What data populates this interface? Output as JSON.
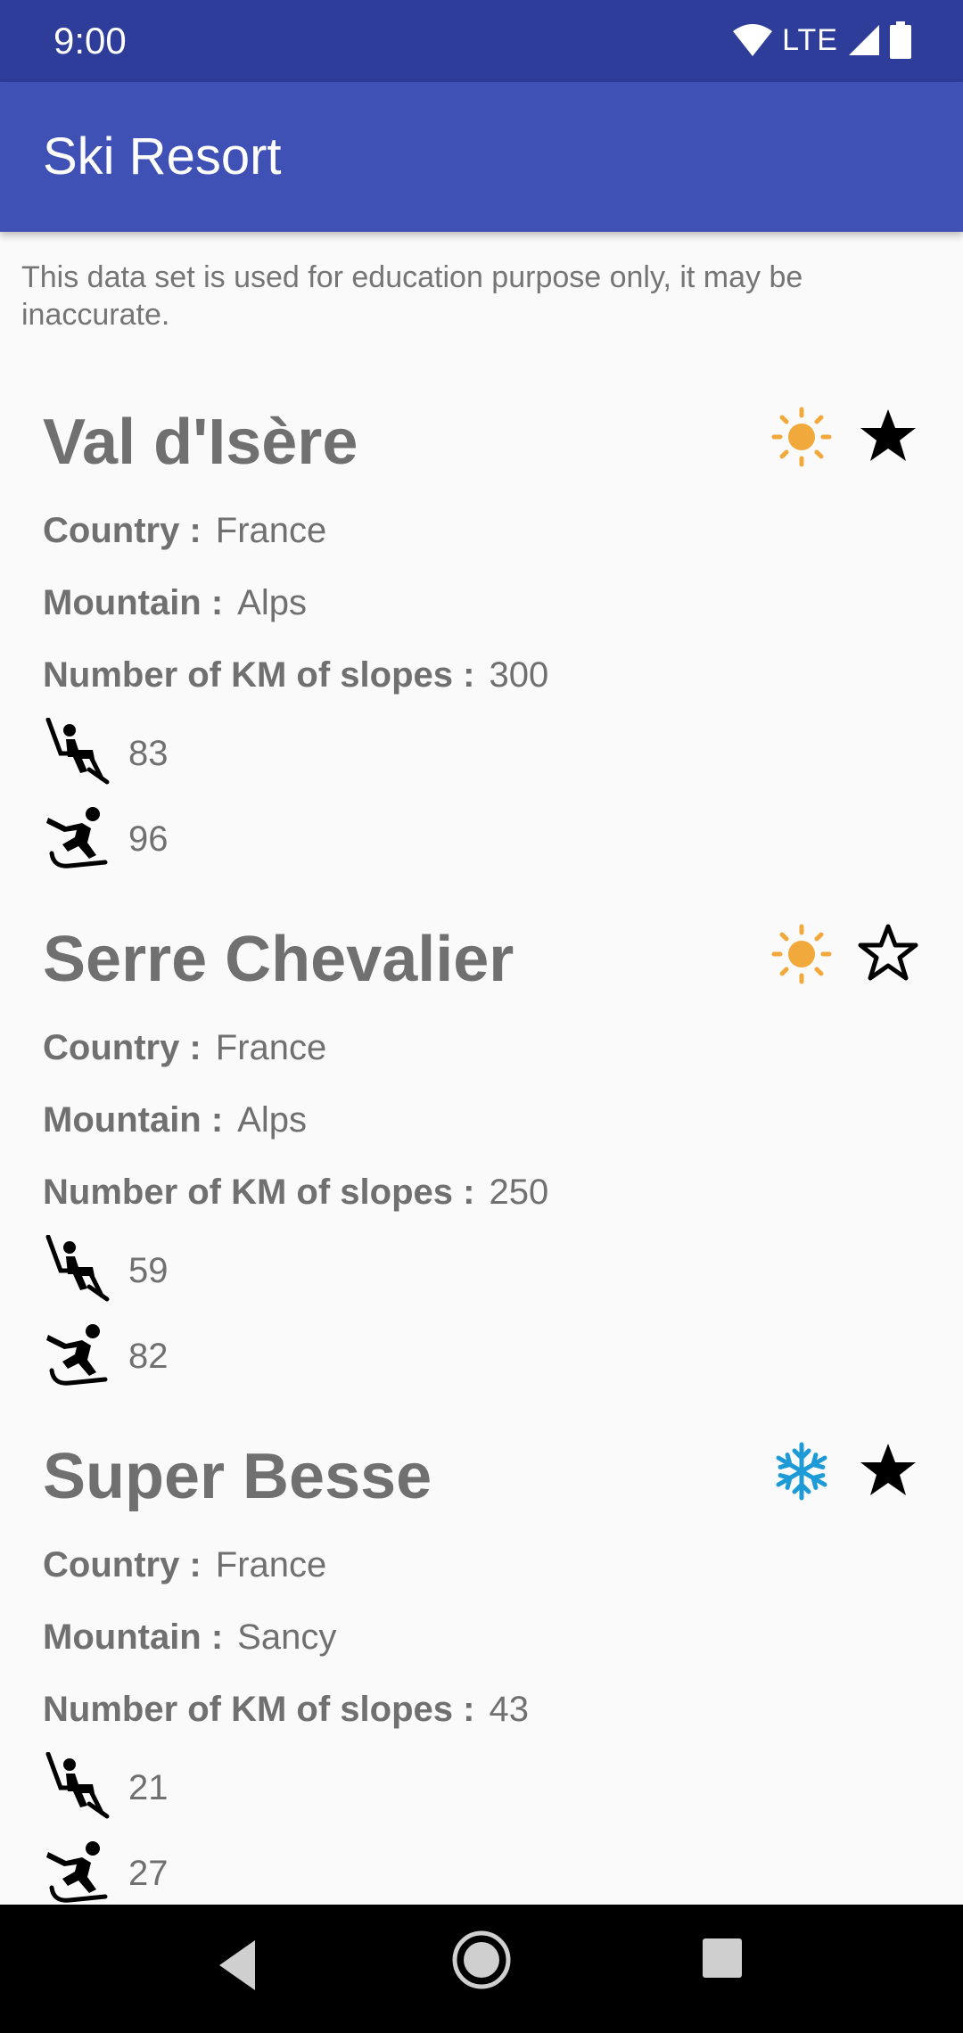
{
  "status_bar": {
    "time": "9:00",
    "network": "LTE",
    "icons": [
      "wifi-icon",
      "signal-icon",
      "battery-icon"
    ]
  },
  "app_bar": {
    "title": "Ski Resort"
  },
  "disclaimer": "This data set is used for education purpose only, it may be inaccurate.",
  "labels": {
    "country": "Country :",
    "mountain": "Mountain :",
    "slopes": "Number of KM of slopes :"
  },
  "resorts": [
    {
      "name": "Val d'Isère",
      "country": "France",
      "mountain": "Alps",
      "slopes_km": "300",
      "lifts": "83",
      "runs": "96",
      "weather": "sun-icon",
      "favorite": true
    },
    {
      "name": "Serre Chevalier",
      "country": "France",
      "mountain": "Alps",
      "slopes_km": "250",
      "lifts": "59",
      "runs": "82",
      "weather": "sun-icon",
      "favorite": false
    },
    {
      "name": "Super Besse",
      "country": "France",
      "mountain": "Sancy",
      "slopes_km": "43",
      "lifts": "21",
      "runs": "27",
      "weather": "snowflake-icon",
      "favorite": true
    }
  ],
  "colors": {
    "status_bar": "#2e3d9a",
    "app_bar": "#3f51b5",
    "sun": "#f2a93b",
    "snow": "#1e9bd7",
    "text": "#707070"
  },
  "nav_bar": {
    "buttons": [
      "back-icon",
      "home-icon",
      "recents-icon"
    ]
  }
}
